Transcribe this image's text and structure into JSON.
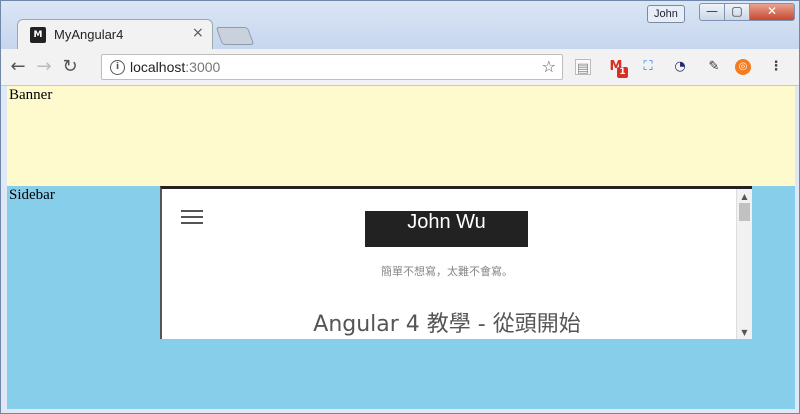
{
  "window": {
    "user": "John",
    "min_glyph": "—",
    "max_glyph": "▢",
    "close_glyph": "✕"
  },
  "tab": {
    "favicon_text": "M",
    "title": "MyAngular4",
    "close_glyph": "×"
  },
  "nav": {
    "back_glyph": "←",
    "forward_glyph": "→",
    "reload_glyph": "↻"
  },
  "address": {
    "host": "localhost",
    "port": ":3000",
    "info_glyph": "i",
    "star_glyph": "☆"
  },
  "extensions": [
    {
      "name": "page-icon",
      "glyph": "▤"
    },
    {
      "name": "gmail-icon",
      "glyph": "M",
      "badge": "1"
    },
    {
      "name": "screen-capture-icon",
      "glyph": "⛶"
    },
    {
      "name": "speed-test-icon",
      "glyph": "◔"
    },
    {
      "name": "eyedropper-icon",
      "glyph": "✎"
    },
    {
      "name": "help-ring-icon",
      "glyph": "◎"
    },
    {
      "name": "chrome-menu-icon",
      "glyph": "⋮"
    }
  ],
  "page": {
    "banner_label": "Banner",
    "sidebar_label": "Sidebar",
    "blog_title": "John Wu",
    "tagline": "簡單不想寫，太難不會寫。",
    "post_title": "Angular 4 教學 - 從頭開始",
    "scroll_up": "▲",
    "scroll_down": "▼"
  },
  "colors": {
    "banner_bg": "#fffacd",
    "sidebar_bg": "#87ceeb"
  }
}
